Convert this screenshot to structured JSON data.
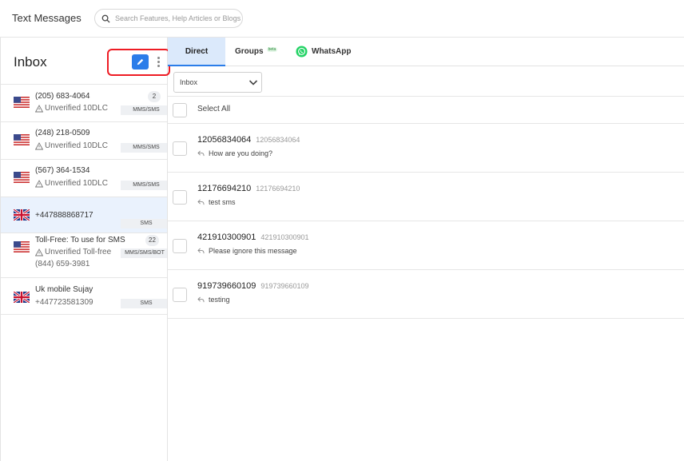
{
  "header": {
    "title": "Text Messages",
    "search_placeholder": "Search Features, Help Articles or Blogs"
  },
  "sidebar": {
    "title": "Inbox",
    "numbers": [
      {
        "flag": "us",
        "title": "(205) 683-4064",
        "sub": "Unverified 10DLC",
        "tag": "MMS/SMS",
        "count": "2",
        "active": false
      },
      {
        "flag": "us",
        "title": "(248) 218-0509",
        "sub": "Unverified 10DLC",
        "tag": "MMS/SMS",
        "active": false
      },
      {
        "flag": "us",
        "title": "(567) 364-1534",
        "sub": "Unverified 10DLC",
        "tag": "MMS/SMS",
        "active": false
      },
      {
        "flag": "uk",
        "title": "+447888868717",
        "tag": "SMS",
        "active": true
      },
      {
        "flag": "us",
        "title": "Toll-Free: To use for SMS",
        "sub": "Unverified Toll-free",
        "extra": "(844) 659-3981",
        "tag": "MMS/SMS/BOT",
        "count": "22",
        "active": false
      },
      {
        "flag": "uk",
        "title": "Uk mobile Sujay",
        "extra": "+447723581309",
        "tag": "SMS",
        "active": false
      }
    ]
  },
  "tabs": {
    "direct": "Direct",
    "groups": "Groups",
    "groups_badge": "beta",
    "whatsapp": "WhatsApp"
  },
  "filter": {
    "selected": "Inbox"
  },
  "select_all": "Select All",
  "messages": [
    {
      "number": "12056834064",
      "sub": "12056834064",
      "preview": "How are you doing?"
    },
    {
      "number": "12176694210",
      "sub": "12176694210",
      "preview": "test sms"
    },
    {
      "number": "421910300901",
      "sub": "421910300901",
      "preview": "Please ignore this message"
    },
    {
      "number": "919739660109",
      "sub": "919739660109",
      "preview": "testing"
    }
  ],
  "colors": {
    "accent": "#2b7de9",
    "highlight": "#ee1c24",
    "whatsapp": "#25d366",
    "active_bg": "#eaf2fd"
  }
}
